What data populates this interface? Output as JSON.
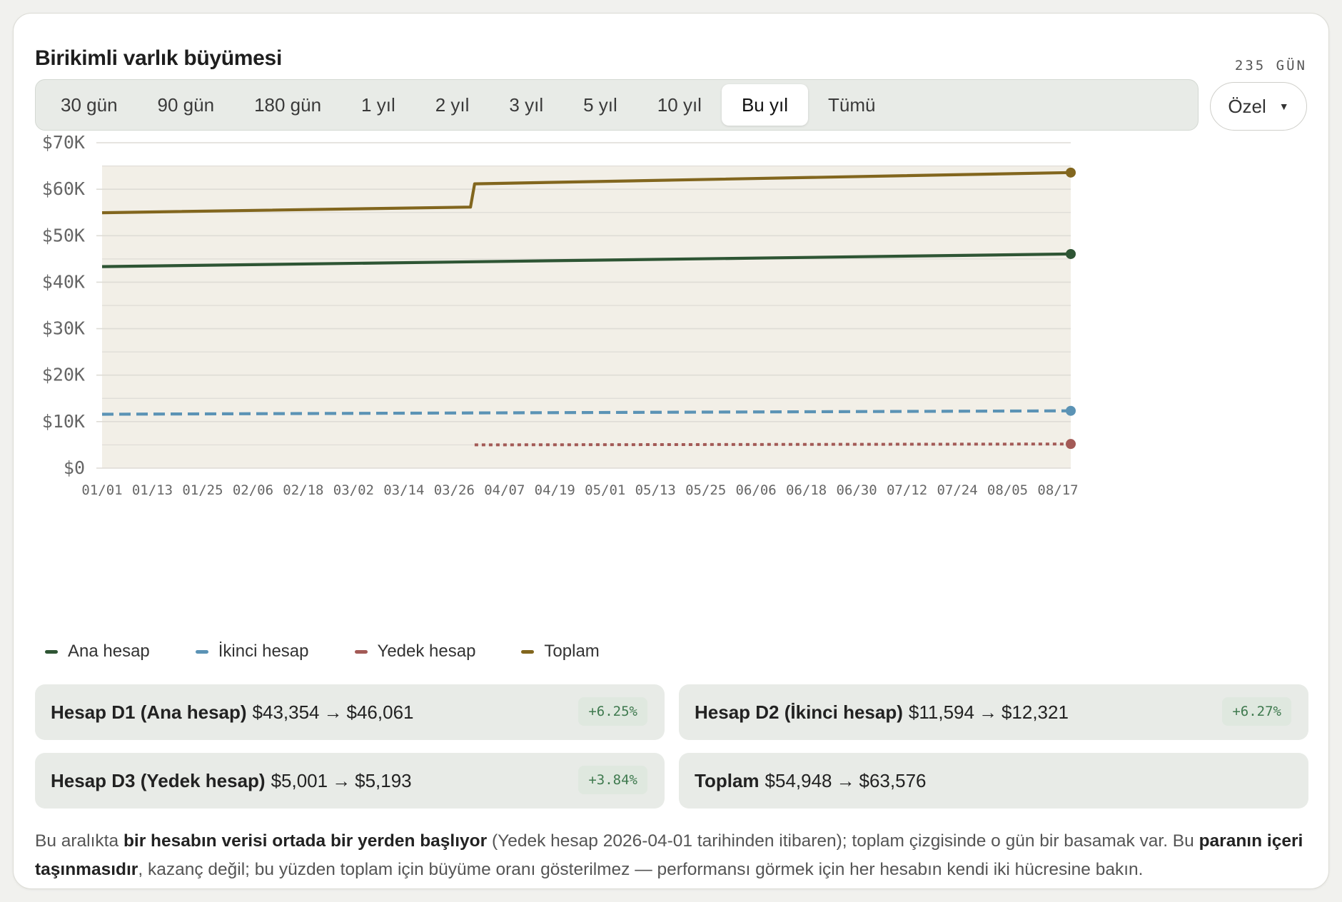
{
  "header": {
    "title": "Birikimli varlık büyümesi",
    "days_label": "235 GÜN"
  },
  "range": {
    "options": [
      "30 gün",
      "90 gün",
      "180 gün",
      "1 yıl",
      "2 yıl",
      "3 yıl",
      "5 yıl",
      "10 yıl",
      "Bu yıl",
      "Tümü"
    ],
    "active": "Bu yıl",
    "custom_label": "Özel"
  },
  "colors": {
    "ana": "#2e5534",
    "ikinci": "#5b93b5",
    "yedek": "#a35a56",
    "toplam": "#82661e",
    "plot_bg": "#f2efe7",
    "grid": "#dedcd6",
    "accent_green": "#3f7a4f"
  },
  "chart_data": {
    "type": "line",
    "title": "Birikimli varlık büyümesi",
    "x_ticks": [
      "01/01",
      "01/13",
      "01/25",
      "02/06",
      "02/18",
      "03/02",
      "03/14",
      "03/26",
      "04/07",
      "04/19",
      "05/01",
      "05/13",
      "05/25",
      "06/06",
      "06/18",
      "06/30",
      "07/12",
      "07/24",
      "08/05",
      "08/17"
    ],
    "y_ticks": [
      "$0",
      "$10K",
      "$20K",
      "$30K",
      "$40K",
      "$50K",
      "$60K",
      "$70K"
    ],
    "ylim": [
      0,
      70000
    ],
    "x_range": [
      "2026-01-01",
      "2026-08-23"
    ],
    "grid": true,
    "legend_position": "bottom-left",
    "series": [
      {
        "name": "Ana hesap",
        "style": "solid",
        "color": "#2e5534",
        "points": [
          [
            "2026-01-01",
            43354
          ],
          [
            "2026-08-23",
            46061
          ]
        ]
      },
      {
        "name": "İkinci hesap",
        "style": "dashed",
        "color": "#5b93b5",
        "points": [
          [
            "2026-01-01",
            11594
          ],
          [
            "2026-08-23",
            12321
          ]
        ]
      },
      {
        "name": "Yedek hesap",
        "style": "dotted",
        "color": "#a35a56",
        "points": [
          [
            "2026-04-01",
            5001
          ],
          [
            "2026-08-23",
            5193
          ]
        ]
      },
      {
        "name": "Toplam",
        "style": "solid",
        "color": "#82661e",
        "points": [
          [
            "2026-01-01",
            54948
          ],
          [
            "2026-03-31",
            56150
          ],
          [
            "2026-04-01",
            61151
          ],
          [
            "2026-08-23",
            63576
          ]
        ]
      }
    ]
  },
  "stats": [
    {
      "name": "Hesap D1 (Ana hesap)",
      "from": "$43,354",
      "to": "$46,061",
      "arrow": "→",
      "change": "+6.25%"
    },
    {
      "name": "Hesap D2 (İkinci hesap)",
      "from": "$11,594",
      "to": "$12,321",
      "arrow": "→",
      "change": "+6.27%"
    },
    {
      "name": "Hesap D3 (Yedek hesap)",
      "from": "$5,001",
      "to": "$5,193",
      "arrow": "→",
      "change": "+3.84%"
    },
    {
      "name": "Toplam",
      "from": "$54,948",
      "to": "$63,576",
      "arrow": "→",
      "change": ""
    }
  ],
  "note": {
    "p1": "Bu aralıkta ",
    "b1": "bir hesabın verisi ortada bir yerden başlıyor",
    "p2": " (Yedek hesap 2026-04-01 tarihinden itibaren); toplam çizgisinde o gün bir basamak var. Bu ",
    "b2": "paranın içeri taşınmasıdır",
    "p3": ", kazanç değil; bu yüzden toplam için büyüme oranı gösterilmez — performansı görmek için her hesabın kendi iki hücresine bakın."
  }
}
